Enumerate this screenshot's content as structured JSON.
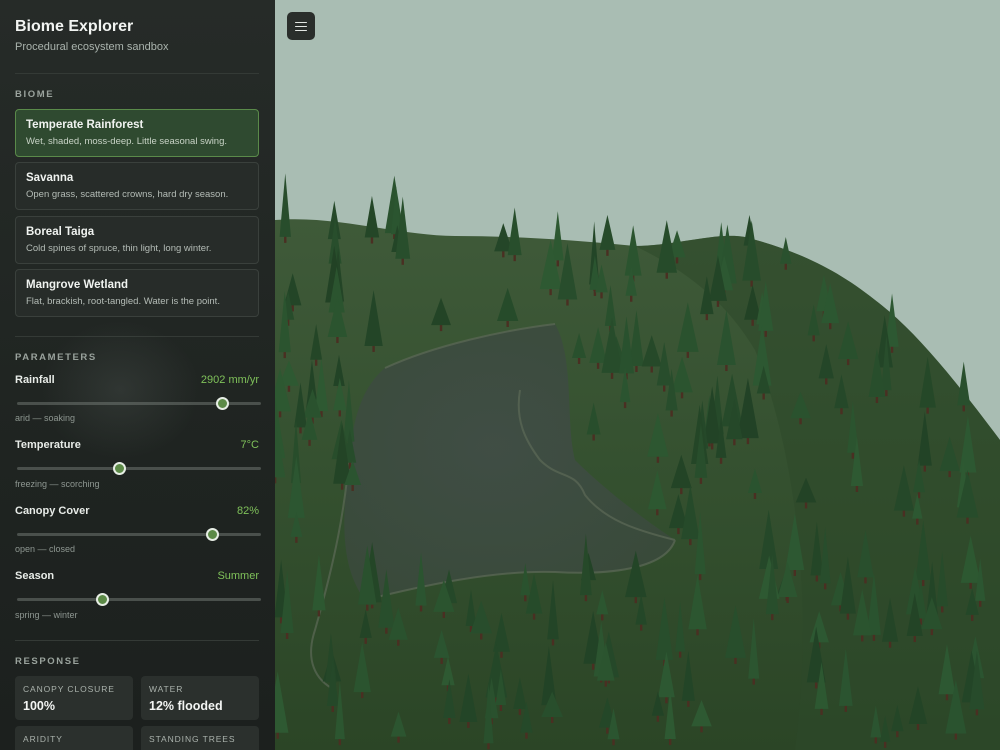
{
  "app": {
    "title": "Biome Explorer",
    "subtitle": "Procedural ecosystem sandbox"
  },
  "biome": {
    "section_label": "BIOME",
    "items": [
      {
        "name": "Temperate Rainforest",
        "desc": "Wet, shaded, moss-deep. Little seasonal swing.",
        "selected": true
      },
      {
        "name": "Savanna",
        "desc": "Open grass, scattered crowns, hard dry season.",
        "selected": false
      },
      {
        "name": "Boreal Taiga",
        "desc": "Cold spines of spruce, thin light, long winter.",
        "selected": false
      },
      {
        "name": "Mangrove Wetland",
        "desc": "Flat, brackish, root-tangled. Water is the point.",
        "selected": false
      }
    ]
  },
  "parameters": {
    "section_label": "PARAMETERS",
    "items": [
      {
        "label": "Rainfall",
        "value": "2902 mm/yr",
        "range": "arid — soaking",
        "fraction": 0.84
      },
      {
        "label": "Temperature",
        "value": "7°C",
        "range": "freezing — scorching",
        "fraction": 0.42
      },
      {
        "label": "Canopy Cover",
        "value": "82%",
        "range": "open — closed",
        "fraction": 0.8
      },
      {
        "label": "Season",
        "value": "Summer",
        "range": "spring — winter",
        "fraction": 0.35
      }
    ]
  },
  "response": {
    "section_label": "RESPONSE",
    "items": [
      {
        "label": "CANOPY CLOSURE",
        "value": "100%"
      },
      {
        "label": "WATER",
        "value": "12% flooded"
      },
      {
        "label": "ARIDITY",
        "value": ""
      },
      {
        "label": "STANDING TREES",
        "value": ""
      }
    ]
  },
  "colors": {
    "accent": "#7fc15a",
    "selected_card": "#2f4a30",
    "sky": "#a9bdb3",
    "terrain": "#2f4a2a"
  },
  "icons": {
    "menu": "hamburger-menu-icon"
  }
}
